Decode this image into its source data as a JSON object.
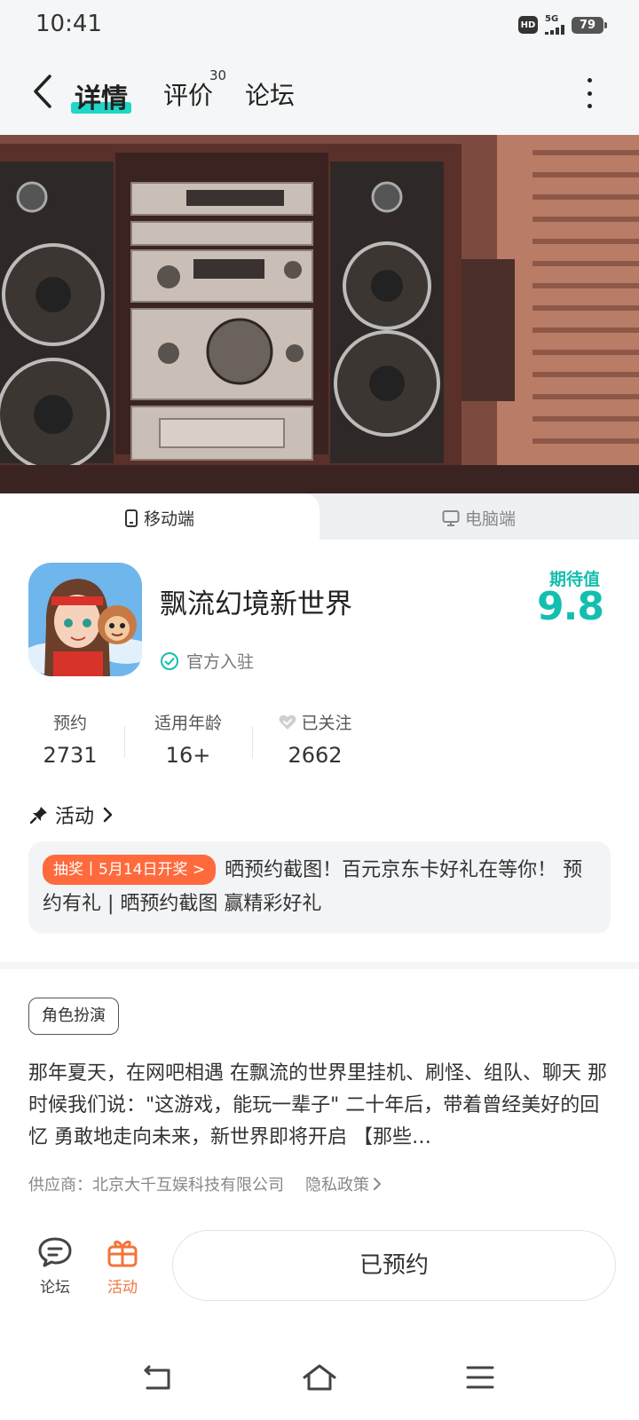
{
  "status_bar": {
    "time": "10:41",
    "hd": "HD",
    "network": "5G",
    "battery": "79"
  },
  "nav": {
    "tabs": [
      {
        "label": "详情"
      },
      {
        "label": "评价",
        "badge": "30"
      },
      {
        "label": "论坛"
      }
    ]
  },
  "platform_tabs": {
    "mobile": "移动端",
    "pc": "电脑端"
  },
  "app": {
    "name": "飘流幻境新世界",
    "official_label": "官方入驻",
    "expect_label": "期待值",
    "expect_score": "9.8"
  },
  "stats": [
    {
      "label": "预约",
      "value": "2731"
    },
    {
      "label": "适用年龄",
      "value": "16+"
    },
    {
      "label": "已关注",
      "value": "2662"
    }
  ],
  "activity": {
    "header": "活动",
    "pill": "抽奖丨5月14日开奖 >",
    "text": "晒预约截图！百元京东卡好礼在等你！ 预约有礼 | 晒预约截图 赢精彩好礼"
  },
  "genre_tag": "角色扮演",
  "description": "那年夏天，在网吧相遇 在飘流的世界里挂机、刷怪、组队、聊天 那时候我们说：\"这游戏，能玩一辈子\" 二十年后，带着曾经美好的回忆 勇敢地走向未来，新世界即将开启 【那些…",
  "supplier": "供应商：北京大千互娱科技有限公司",
  "privacy": "隐私政策",
  "bottom_bar": {
    "forum": "论坛",
    "activity": "活动",
    "reserve_button": "已预约"
  },
  "colors": {
    "accent": "#13bfae",
    "tab_underline": "#1ed7c6",
    "orange": "#ff6a3d",
    "activity_orange": "#f2753a"
  }
}
